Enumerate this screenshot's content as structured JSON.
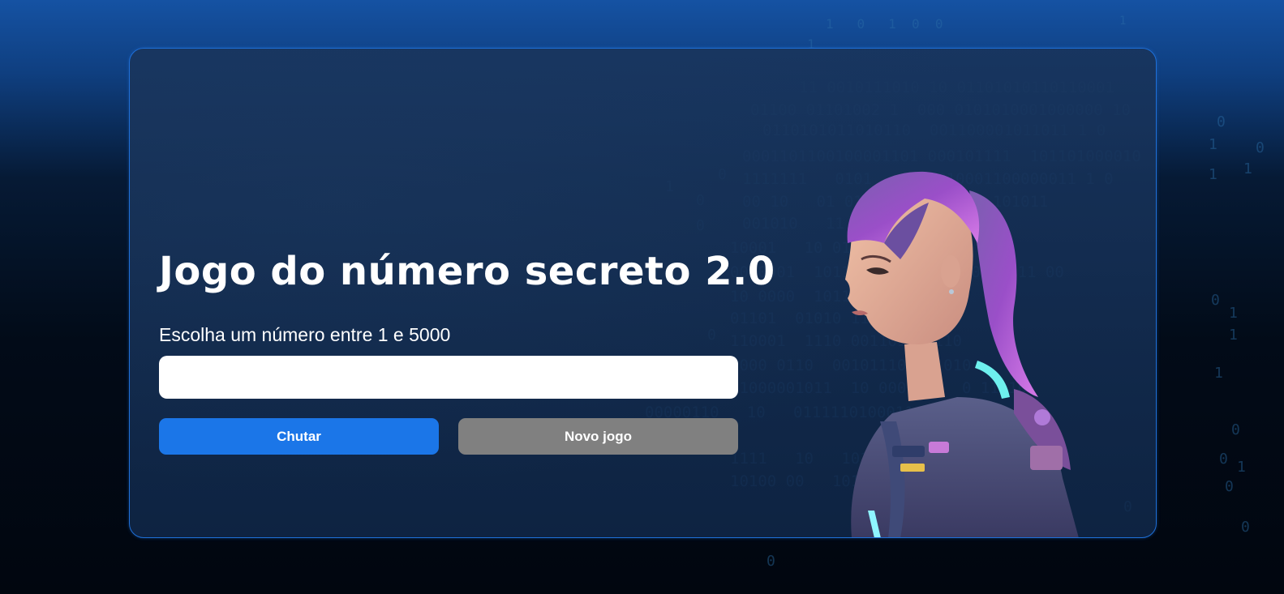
{
  "game": {
    "title": "Jogo do número secreto 2.0",
    "prompt": "Escolha um número entre 1 e 5000",
    "input_value": "",
    "input_placeholder": ""
  },
  "buttons": {
    "guess_label": "Chutar",
    "new_game_label": "Novo jogo"
  },
  "illustration": {
    "icon": "robot-girl-illustration-icon",
    "description_visible": false
  },
  "colors": {
    "accent_blue": "#1b76e8",
    "button_gray": "#808080",
    "container_border": "#1e6fd8"
  }
}
